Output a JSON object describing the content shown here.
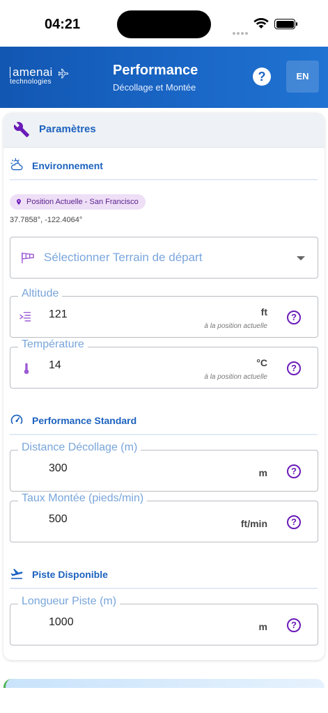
{
  "status_bar": {
    "time": "04:21"
  },
  "header": {
    "logo_top": "amenai",
    "logo_bottom": "technologies",
    "title": "Performance",
    "subtitle": "Décollage et Montée",
    "help_label": "?",
    "lang_label": "EN"
  },
  "card": {
    "title": "Paramètres",
    "environment": {
      "title": "Environnement",
      "location_chip": "Position Actuelle - San Francisco",
      "coordinates": "37.7858°, -122.4064°",
      "select_placeholder": "Sélectionner Terrain de départ",
      "altitude": {
        "label": "Altitude",
        "value": "121",
        "unit": "ft",
        "hint": "à la position actuelle"
      },
      "temperature": {
        "label": "Température",
        "value": "14",
        "unit": "°C",
        "hint": "à la position actuelle"
      }
    },
    "standard": {
      "title": "Performance Standard",
      "takeoff_distance": {
        "label": "Distance Décollage (m)",
        "value": "300",
        "unit": "m"
      },
      "climb_rate": {
        "label": "Taux Montée (pieds/min)",
        "value": "500",
        "unit": "ft/min"
      }
    },
    "runway": {
      "title": "Piste Disponible",
      "length": {
        "label": "Longueur Piste (m)",
        "value": "1000",
        "unit": "m"
      }
    },
    "help_glyph": "?"
  },
  "colors": {
    "header_blue": "#1a62c2",
    "accent_blue": "#1c62bf",
    "label_blue": "#78a5da",
    "help_purple": "#6a1bb8",
    "chip_bg": "#eedff7"
  }
}
